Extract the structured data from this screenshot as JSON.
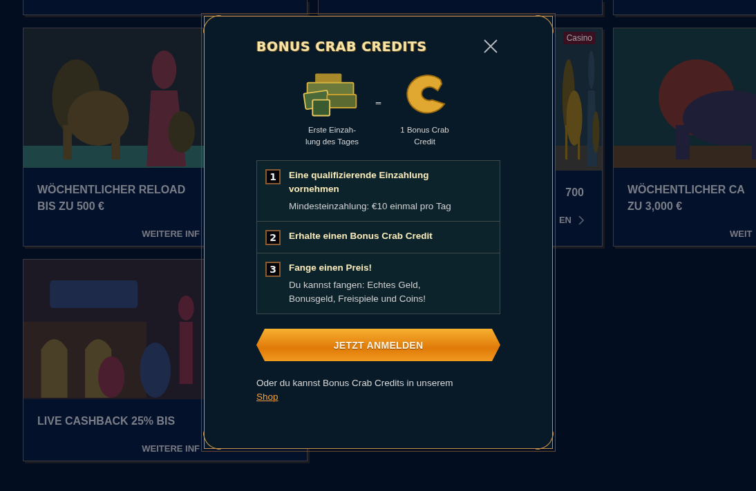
{
  "cards": [
    {
      "kind": "left",
      "title_lines": [
        "WÖCHENTLICHER RELOAD",
        "BIS ZU 500 €"
      ],
      "link": "WEITERE INF"
    },
    {
      "kind": "middle",
      "tag": "Casino",
      "title_lines": [
        "700"
      ],
      "link": "EN"
    },
    {
      "kind": "right",
      "title_lines": [
        "WÖCHENTLICHER CA",
        "ZU 3,000 €"
      ],
      "link": "WEIT"
    },
    {
      "kind": "left",
      "title_lines": [
        "LIVE CASHBACK 25% BIS"
      ],
      "link": "WEITERE INF"
    }
  ],
  "modal": {
    "title": "BONUS CRAB CREDITS",
    "exchange": {
      "left_caption": "Erste Einzah-\nlung des Tages",
      "equals": "=",
      "right_caption": "1 Bonus Crab\nCredit"
    },
    "steps": [
      {
        "number": "1",
        "title": "Eine qualifizierende Einzahlung\nvornehmen",
        "text": "Mindesteinzahlung: €10 einmal pro Tag"
      },
      {
        "number": "2",
        "title": "Erhalte einen Bonus Crab Credit"
      },
      {
        "number": "3",
        "title": "Fange einen Preis!",
        "text": "Du kannst fangen: Echtes Geld,\nBonusgeld, Freispiele und Coins!"
      }
    ],
    "button": "JETZT ANMELDEN",
    "footer": "Oder du kannst Bonus Crab Credits in unserem",
    "footer_link": "Shop"
  }
}
